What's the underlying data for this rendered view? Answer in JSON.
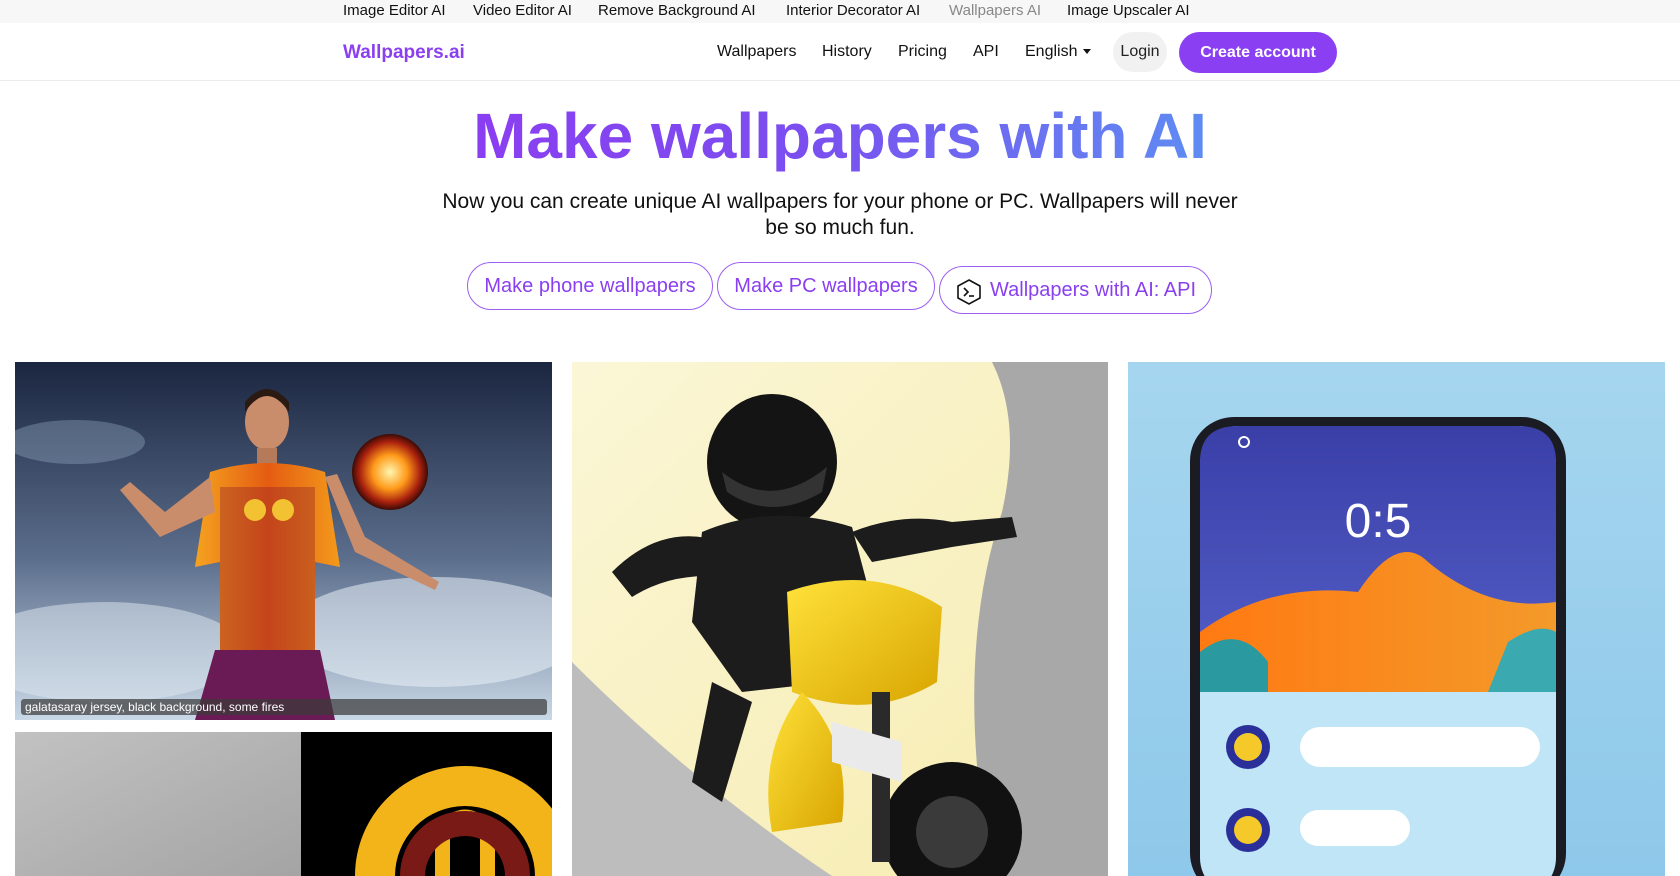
{
  "top_links": [
    {
      "label": "Image Editor AI",
      "current": false
    },
    {
      "label": "Video Editor AI",
      "current": false
    },
    {
      "label": "Remove Background AI",
      "current": false
    },
    {
      "label": "Interior Decorator AI",
      "current": false
    },
    {
      "label": "Wallpapers AI",
      "current": true
    },
    {
      "label": "Image Upscaler AI",
      "current": false
    }
  ],
  "navbar": {
    "brand": "Wallpapers.ai",
    "links": [
      "Wallpapers",
      "History",
      "Pricing",
      "API"
    ],
    "language": "English",
    "login": "Login",
    "create_account": "Create account"
  },
  "hero": {
    "title": "Make wallpapers with AI",
    "subtitle": "Now you can create unique AI wallpapers for your phone or PC. Wallpapers will never be so much fun.",
    "buttons": {
      "phone": "Make phone wallpapers",
      "pc": "Make PC wallpapers",
      "api": "Wallpapers with AI: API"
    }
  },
  "gallery": {
    "caption_1": "galatasaray jersey, black background, some fires",
    "phone_clock": "0:5"
  },
  "colors": {
    "brand": "#8a3ff0",
    "gradient_start": "#8a3ef1",
    "gradient_end": "#5e8cf2"
  }
}
